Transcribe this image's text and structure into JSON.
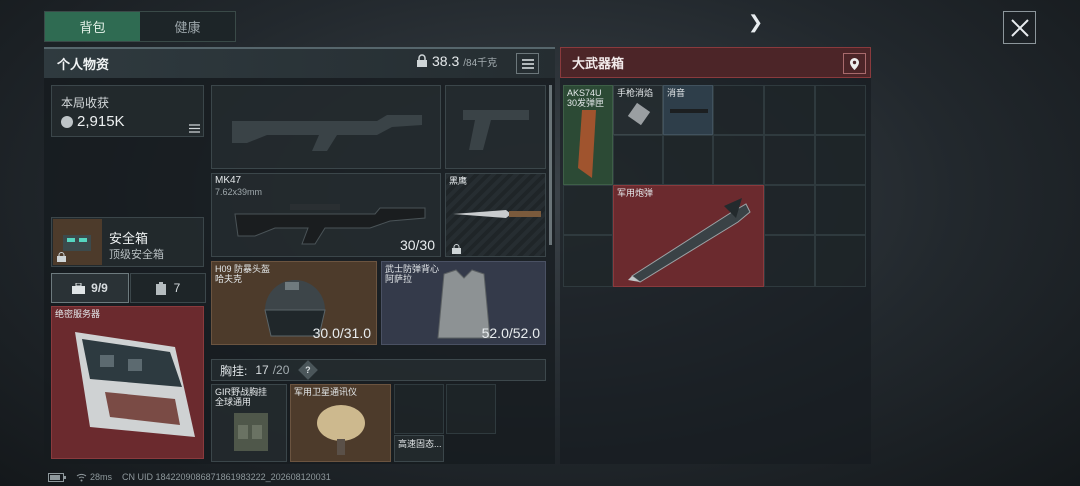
{
  "tabs": [
    {
      "label": "背包"
    },
    {
      "label": "健康"
    }
  ],
  "left_panel": {
    "title": "个人物资",
    "weight_current": "38.3",
    "weight_max": "/84千克",
    "income": {
      "label": "本局收获",
      "value": "2,915K"
    },
    "safebox": {
      "title": "安全箱",
      "subtitle": "顶级安全箱"
    },
    "pouch_tabs": [
      {
        "label": "9/9"
      },
      {
        "label": "7"
      }
    ],
    "server": {
      "label": "绝密服务器"
    },
    "weapon1": {
      "name": "MK47",
      "sub": "7.62x39mm",
      "ammo": "30/30"
    },
    "knife": {
      "name": "黑鹰"
    },
    "helmet": {
      "name": "H09 防暴头盔",
      "sub": "哈夫克",
      "durability": "30.0/31.0"
    },
    "armor": {
      "name": "武士防弹背心",
      "sub": "阿萨拉",
      "durability": "52.0/52.0"
    },
    "chest_rig": {
      "label": "胸挂:",
      "count": "17",
      "max": "/20",
      "help": "?"
    },
    "rig_items": [
      {
        "name": "GIR野战胸挂",
        "sub": "全球通用"
      },
      {
        "name": "军用卫星通讯仪"
      },
      {
        "name": "高速固态..."
      }
    ]
  },
  "right_panel": {
    "title": "大武器箱",
    "items": [
      {
        "name": "AKS74U",
        "sub": "30发弹匣"
      },
      {
        "name": "手枪消焰"
      },
      {
        "name": "消音"
      },
      {
        "name": "军用炮弹"
      }
    ]
  },
  "status_bar": {
    "ping": "28ms",
    "uid": "CN UID 1842209086871861983222_202608120031"
  },
  "colors": {
    "accent_green": "#2f6b52",
    "accent_red": "#4c2528",
    "item_red": "#6b2a2e",
    "item_brown": "#4d3b2b"
  }
}
